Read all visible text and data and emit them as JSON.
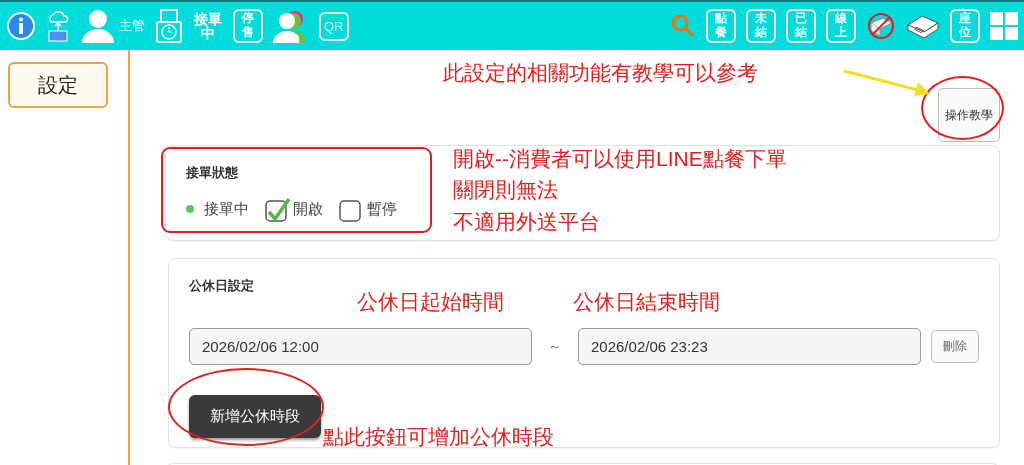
{
  "toolbar": {
    "supervisor_label": "主管",
    "order_status_label": "接單中",
    "stop_sale_label": "停售",
    "qr_label": "QR",
    "right_boxes": [
      {
        "label": "點餐"
      },
      {
        "label": "未結"
      },
      {
        "label": "已結"
      },
      {
        "label": "線上"
      }
    ],
    "seats_label": "座位"
  },
  "sidebar": {
    "items": [
      {
        "label": "設定",
        "selected": true
      }
    ]
  },
  "tutorial_button": "操作教學",
  "order_status": {
    "title": "接單狀態",
    "indicator": {
      "label": "接單中",
      "active": true
    },
    "options": [
      {
        "label": "開啟",
        "checked": true
      },
      {
        "label": "暫停",
        "checked": false
      }
    ]
  },
  "holiday": {
    "title": "公休日設定",
    "periods": [
      {
        "start": "2026/02/06 12:00",
        "separator": "～",
        "end": "2026/02/06 23:23",
        "delete_button": "刪除"
      }
    ],
    "add_button": "新增公休時段"
  },
  "annotations": [
    {
      "kind": "note",
      "text": "此設定的相關功能有教學可以參考"
    },
    {
      "kind": "note",
      "text": "開啟--消費者可以使用LINE點餐下單"
    },
    {
      "kind": "note",
      "text": "關閉則無法"
    },
    {
      "kind": "note",
      "text": "不適用外送平台"
    },
    {
      "kind": "note",
      "text": "公休日起始時間"
    },
    {
      "kind": "note",
      "text": "公休日結束時間"
    },
    {
      "kind": "note",
      "text": "點此按鈕可增加公休時段"
    }
  ]
}
